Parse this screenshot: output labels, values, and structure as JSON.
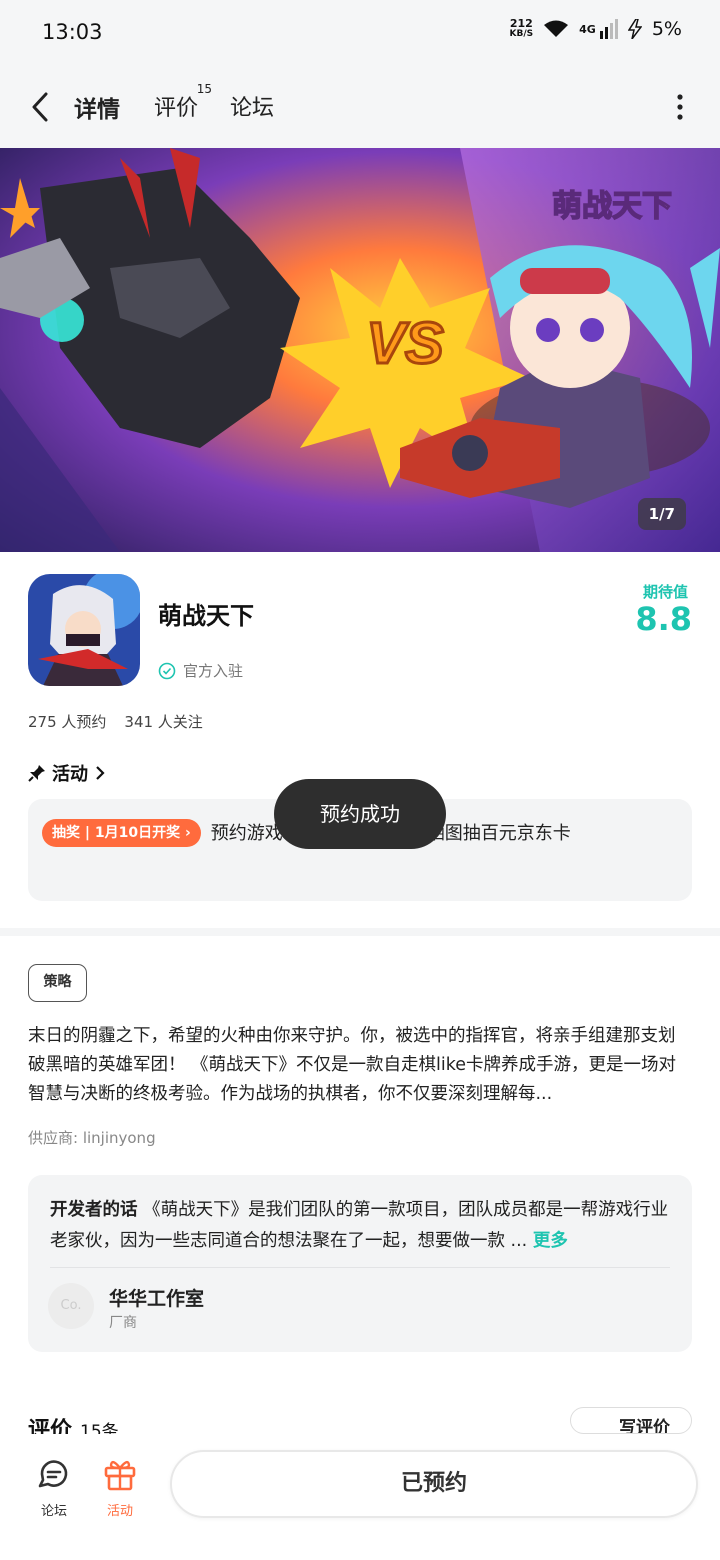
{
  "status_bar": {
    "time": "13:03",
    "net_speed_value": "212",
    "net_speed_unit": "KB/S",
    "network": "4G",
    "battery": "5%"
  },
  "nav": {
    "tabs": [
      {
        "label": "详情"
      },
      {
        "label": "评价",
        "badge": "15"
      },
      {
        "label": "论坛"
      }
    ]
  },
  "banner": {
    "logo_text": "萌战天下",
    "vs_text": "VS",
    "counter": "1/7"
  },
  "app": {
    "name": "萌战天下",
    "official": "官方入驻",
    "expect_label": "期待值",
    "expect_value": "8.8",
    "reservations": "275 人预约",
    "followers": "341 人关注"
  },
  "activity": {
    "title": "活动",
    "badge": "抽奖 | 1月10日开奖",
    "text": "预约游戏【有奖活动】预约晒图抽百元京东卡"
  },
  "toast": "预约成功",
  "game": {
    "tag": "策略",
    "description": "末日的阴霾之下，希望的火种由你来守护。你，被选中的指挥官，将亲手组建那支划破黑暗的英雄军团！ 《萌战天下》不仅是一款自走棋like卡牌养成手游，更是一场对智慧与决断的终极考验。作为战场的执棋者，你不仅要深刻理解每...",
    "supplier": "供应商: linjinyong"
  },
  "developer": {
    "label": "开发者的话",
    "text": "《萌战天下》是我们团队的第一款项目，团队成员都是一帮游戏行业老家伙，因为一些志同道合的想法聚在了一起，想要做一款 ...",
    "more": "更多",
    "avatar_text": "Co.",
    "studio_name": "华华工作室",
    "studio_role": "厂商"
  },
  "reviews": {
    "title": "评价",
    "count": "15条",
    "write_label": "写评价"
  },
  "bottom_bar": {
    "forum_label": "论坛",
    "activity_label": "活动",
    "reserved_label": "已预约"
  },
  "colors": {
    "accent": "#1ec4b0",
    "orange": "#ff6b3d",
    "toast_bg": "#2e2e2e"
  }
}
